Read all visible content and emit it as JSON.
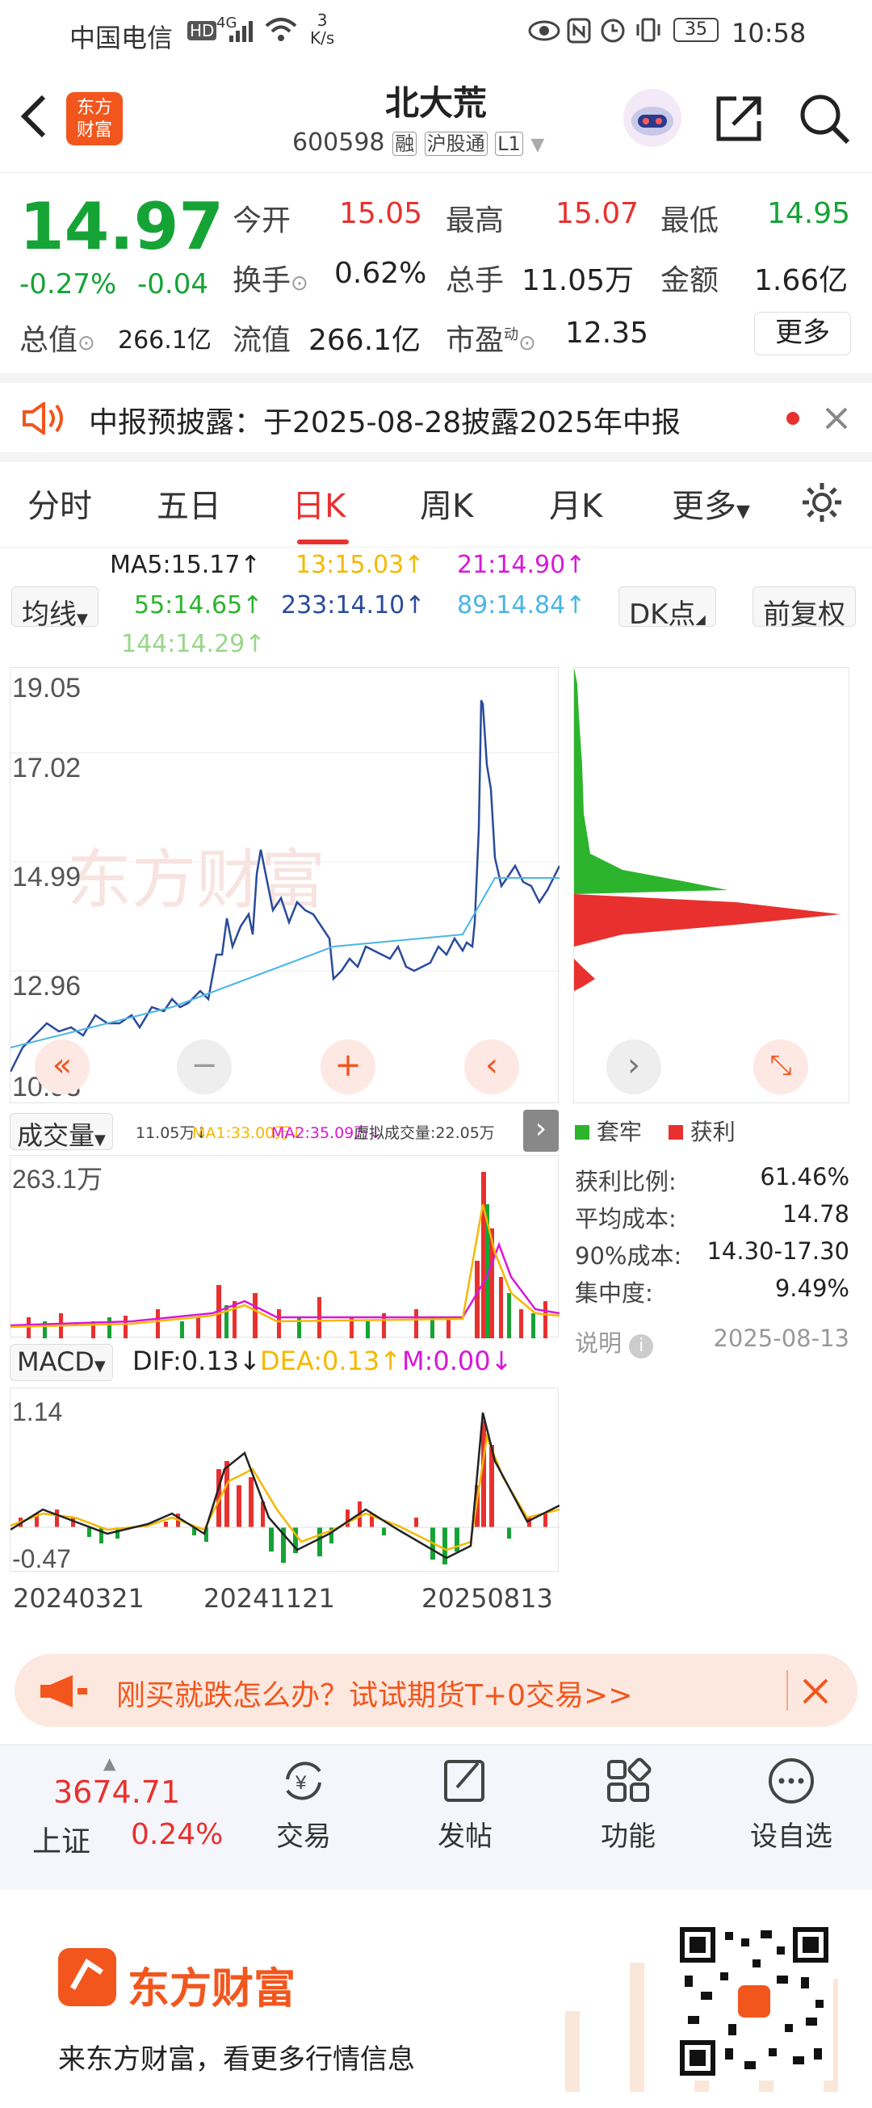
{
  "status": {
    "carrier": "中国电信",
    "hd": "HD",
    "net": "4G",
    "speed": "3",
    "speed_unit": "K/s",
    "battery": "35",
    "time": "10:58"
  },
  "header": {
    "logo_line1": "东方",
    "logo_line2": "财富",
    "stock_name": "北大荒",
    "code": "600598",
    "tag_rong": "融",
    "tag_hgt": "沪股通",
    "tag_level": "L1"
  },
  "quote": {
    "price": "14.97",
    "change_pct": "-0.27%",
    "change": "-0.04",
    "open_label": "今开",
    "open": "15.05",
    "high_label": "最高",
    "high": "15.07",
    "low_label": "最低",
    "low": "14.95",
    "turnover_label": "换手",
    "turnover": "0.62%",
    "volume_label": "总手",
    "volume": "11.05万",
    "amount_label": "金额",
    "amount": "1.66亿",
    "mktcap_label": "总值",
    "mktcap": "266.1亿",
    "float_label": "流值",
    "float_cap": "266.1亿",
    "pe_label": "市盈",
    "pe_sup": "动",
    "pe": "12.35",
    "more_label": "更多"
  },
  "notice": {
    "text": "中报预披露：于2025-08-28披露2025年中报"
  },
  "tabs": [
    "分时",
    "五日",
    "日K",
    "周K",
    "月K",
    "更多"
  ],
  "ma": {
    "selector": "均线",
    "ma5": "MA5:15.17↑",
    "ma13": "13:15.03↑",
    "ma21": "21:14.90↑",
    "ma55": "55:14.65↑",
    "ma233": "233:14.10↑",
    "ma89": "89:14.84↑",
    "ma144": "144:14.29↑",
    "dk": "DK点",
    "fq": "前复权"
  },
  "main_chart": {
    "y_labels": [
      "19.05",
      "17.02",
      "14.99",
      "12.96",
      "10.93"
    ]
  },
  "chips": {
    "legend_trapped": "套牢",
    "legend_profit": "获利",
    "rows": [
      {
        "label": "获利比例:",
        "value": "61.46%"
      },
      {
        "label": "平均成本:",
        "value": "14.78"
      },
      {
        "label": "90%成本:",
        "value": "14.30-17.30"
      },
      {
        "label": "集中度:",
        "value": "9.49%"
      }
    ],
    "note_label": "说明",
    "date": "2025-08-13"
  },
  "volume": {
    "selector": "成交量",
    "vol": "11.05万↓",
    "ma1": "MA1:33.00万↓",
    "ma2": "MA2:35.09万↓",
    "virtual": "虚拟成交量:22.05万",
    "max_label": "263.1万"
  },
  "macd": {
    "selector": "MACD",
    "dif": "DIF:0.13↓",
    "dea": "DEA:0.13↑",
    "m": "M:0.00↓",
    "max_label": "1.14",
    "min_label": "-0.47",
    "dates": [
      "20240321",
      "20241121",
      "20250813"
    ]
  },
  "ad": {
    "text": "刚买就跌怎么办？试试期货T+0交易>>"
  },
  "bottom": {
    "index_value": "3674.71",
    "index_name": "上证",
    "index_change": "0.24%",
    "trade": "交易",
    "post": "发帖",
    "func": "功能",
    "watch": "设自选"
  },
  "footer": {
    "brand": "东方财富",
    "slogan": "来东方财富，看更多行情信息"
  },
  "colors": {
    "up": "#e8312f",
    "down": "#16a336",
    "ma5": "#222222",
    "ma13": "#f5b800",
    "ma21": "#d818d8",
    "ma55": "#2db42d",
    "ma233": "#2a4b9b",
    "ma89": "#4ab5e6",
    "ma144": "#9ad68a"
  }
}
